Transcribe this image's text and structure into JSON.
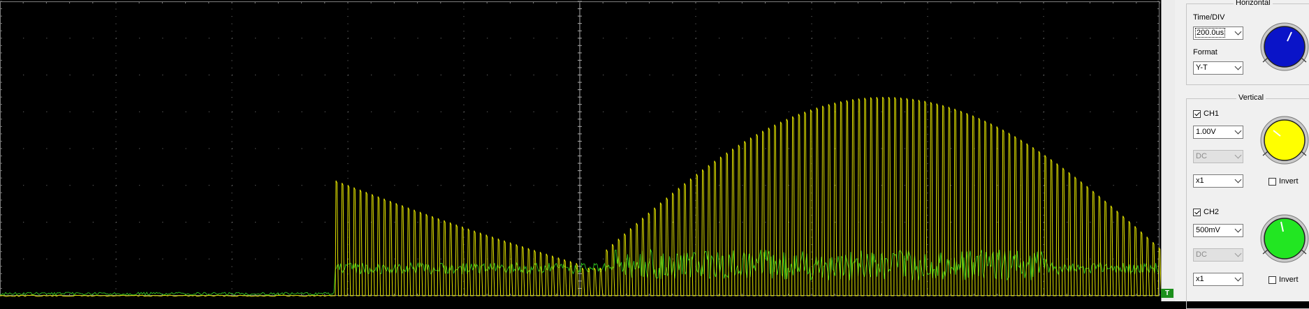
{
  "horizontal": {
    "title": "Horizontal",
    "time_div_label": "Time/DIV",
    "time_div_value": "200.0us",
    "format_label": "Format",
    "format_value": "Y-T",
    "knob_color": "#0a14c8"
  },
  "vertical": {
    "title": "Vertical",
    "ch1": {
      "label": "CH1",
      "enabled": true,
      "volts_div": "1.00V",
      "coupling": "DC",
      "probe": "x1",
      "invert_label": "Invert",
      "invert": false,
      "color": "#ffff00"
    },
    "ch2": {
      "label": "CH2",
      "enabled": true,
      "volts_div": "500mV",
      "coupling": "DC",
      "probe": "x1",
      "invert_label": "Invert",
      "invert": false,
      "color": "#22e622"
    }
  },
  "trigger_marker": "T",
  "scope": {
    "background": "#000000",
    "grid_color": "#7f7f7f",
    "ch1_trace_color": "#e6e600",
    "ch2_trace_color": "#33dd22"
  }
}
